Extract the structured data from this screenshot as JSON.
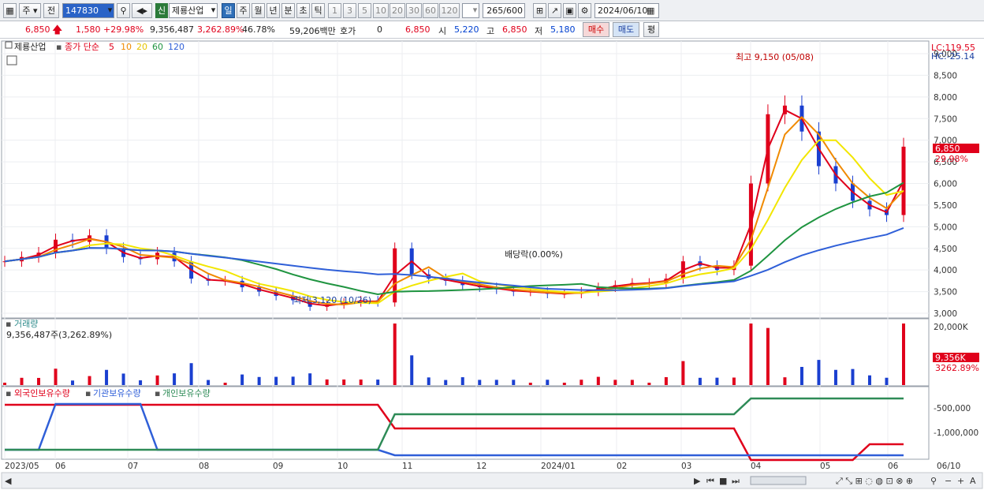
{
  "toolbar": {
    "market": "주",
    "prev": "전",
    "code": "147830",
    "new_badge": "신",
    "name": "제룡산업",
    "periods": [
      "일",
      "주",
      "월",
      "년",
      "분",
      "초",
      "틱"
    ],
    "active_period": "일",
    "intervals": [
      "1",
      "3",
      "5",
      "10",
      "20",
      "30",
      "60",
      "120"
    ],
    "count_value": "265",
    "count_total": "/600",
    "date": "2024/06/10"
  },
  "quote": {
    "price": "6,850",
    "change": "1,580",
    "change_pct": "+29.98%",
    "volume": "9,356,487",
    "volume_pct": "3,262.89%",
    "turnover_rate": "46.78%",
    "amount": "59,206백만",
    "hoga_label": "호가",
    "hoga_value": "0",
    "hoga_price": "6,850",
    "open_label": "시",
    "open": "5,220",
    "high_label": "고",
    "high": "6,850",
    "low_label": "저",
    "low": "5,180",
    "buy_label": "매수",
    "sell_label": "매도",
    "avg_label": "평"
  },
  "legend": {
    "stock_name": "제룡산업",
    "ma_label": "종가 단순",
    "ma_periods": [
      "5",
      "10",
      "20",
      "60",
      "120"
    ],
    "volume_title": "거래량",
    "volume_info": "9,356,487주(3,262.89%)",
    "holders": [
      "외국인보유수량",
      "기관보유수량",
      "개인보유수량"
    ]
  },
  "colors": {
    "ma5": "#e0001b",
    "ma10": "#f08a00",
    "ma20": "#f2e600",
    "ma60": "#1f9440",
    "ma120": "#2f5fd8",
    "foreign": "#e0001b",
    "institution": "#2f5fd8",
    "individual": "#2e8b57",
    "up": "#e0001b",
    "down": "#1a3fd0"
  },
  "annotations": {
    "high": "최고 9,150 (05/08)",
    "low": "최저 3,120 (10/26)",
    "dividend": "배당락(0.00%)",
    "lc": "LC:119.55",
    "hc": "HC:-25.14",
    "price_tag": "6,850",
    "pct_tag": "29.98%",
    "vol_tag": "9,356K",
    "vol_pct_tag": "3262.89%"
  },
  "chart_data": [
    {
      "type": "candlestick",
      "title": "제룡산업",
      "x_range": [
        "2023/05",
        "2024/06/10"
      ],
      "ylim": [
        3000,
        9000
      ],
      "y_ticks": [
        "3,000",
        "3,500",
        "4,000",
        "4,500",
        "5,000",
        "5,500",
        "6,000",
        "6,500",
        "7,000",
        "7,500",
        "8,000",
        "8,500",
        "9,000"
      ],
      "x_ticks": [
        "2023/05",
        "06",
        "07",
        "08",
        "09",
        "10",
        "11",
        "12",
        "2024/01",
        "02",
        "03",
        "04",
        "05",
        "06",
        "06/10"
      ],
      "close_approx": [
        4200,
        4300,
        4400,
        4700,
        4650,
        4800,
        4500,
        4300,
        4250,
        4400,
        4200,
        3800,
        3750,
        3750,
        3600,
        3500,
        3400,
        3300,
        3150,
        3200,
        3250,
        3300,
        3250,
        4500,
        3900,
        3800,
        3750,
        3650,
        3600,
        3550,
        3500,
        3500,
        3450,
        3450,
        3500,
        3600,
        3650,
        3700,
        3700,
        3800,
        4200,
        4100,
        4000,
        4100,
        6000,
        7600,
        7800,
        7200,
        6400,
        6000,
        5600,
        5400,
        5270,
        6850
      ],
      "ma_periods": [
        5,
        10,
        20,
        60,
        120
      ]
    },
    {
      "type": "bar",
      "title": "거래량",
      "y_ticks": [
        "20,000K"
      ],
      "last_value": "9,356,487"
    },
    {
      "type": "line",
      "series_names": [
        "외국인보유수량",
        "기관보유수량",
        "개인보유수량"
      ],
      "y_ticks": [
        "-500,000",
        "-1,000,000"
      ]
    }
  ]
}
